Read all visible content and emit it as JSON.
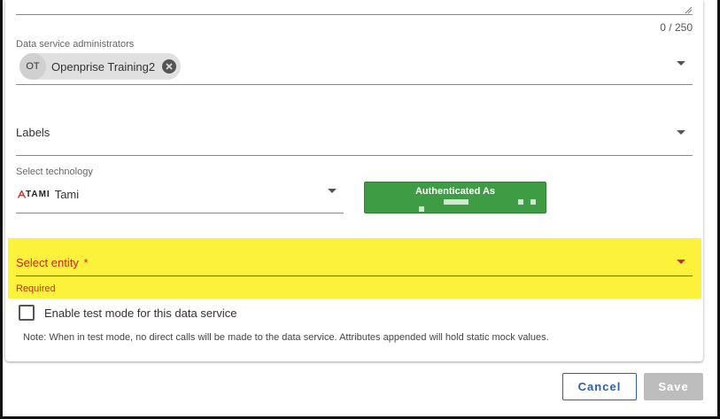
{
  "description_field": {
    "counter": "0 / 250"
  },
  "administrators": {
    "label": "Data service administrators",
    "chip": {
      "initials": "OT",
      "name": "Openprise Training2"
    }
  },
  "labels_field": {
    "label": "Labels"
  },
  "technology": {
    "label": "Select technology",
    "logo_text": "TAMI",
    "value": "Tami"
  },
  "auth_button": {
    "title": "Authenticated As",
    "color": "#3e9c45"
  },
  "entity": {
    "label": "Select entity",
    "required_marker": "*",
    "error": "Required",
    "highlight_color": "#fcf23c",
    "error_color": "#c62828"
  },
  "test_mode": {
    "label": "Enable test mode for this data service",
    "checked": false,
    "note": "Note: When in test mode, no direct calls will be made to the data service. Attributes appended will hold static mock values."
  },
  "footer": {
    "cancel_label": "Cancel",
    "save_label": "Save"
  }
}
